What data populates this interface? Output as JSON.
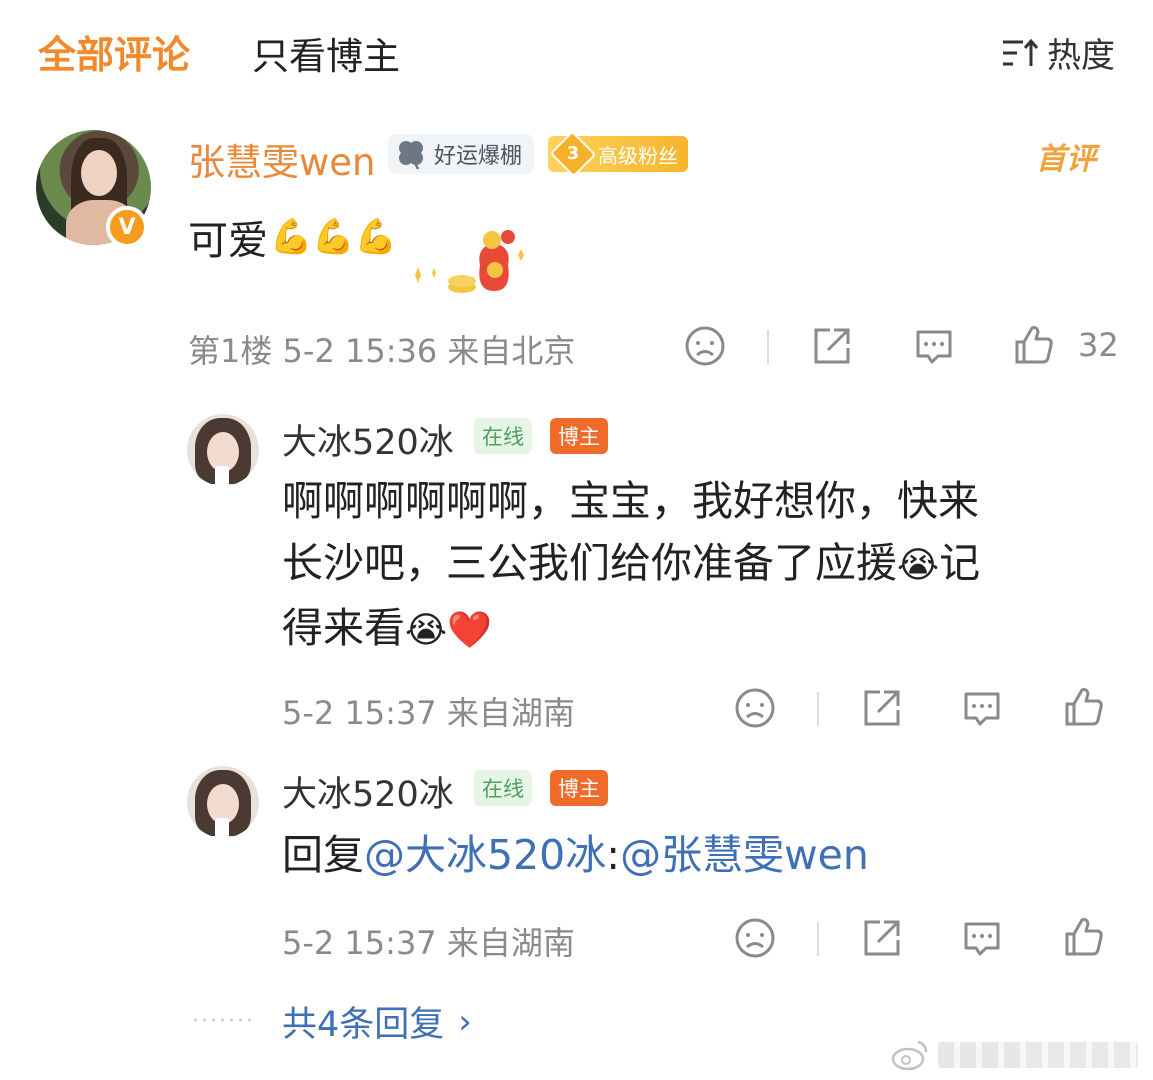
{
  "tabs": {
    "all_comments": "全部评论",
    "blogger_only": "只看博主",
    "sort_label": "热度",
    "sort_icon": "sort-icon"
  },
  "main_comment": {
    "author": "张慧雯wen",
    "verified_badge": "V",
    "luck_badge": "好运爆棚",
    "fan_level": "3",
    "fan_badge": "高级粉丝",
    "first_label": "首评",
    "text": "可爱",
    "emoji": "💪💪💪",
    "floor": "第1楼",
    "time": "5-2 15:36",
    "location": "来自北京",
    "like_count": "32"
  },
  "replies": [
    {
      "author": "大冰520冰",
      "tag_online": "在线",
      "tag_blogger": "博主",
      "text_lines": [
        "啊啊啊啊啊啊，宝宝，我好想你，快来",
        "长沙吧，三公我们给你准备了应援"
      ],
      "text_suffix_1": "记",
      "text_line3": "得来看",
      "emoji_cry": "😭",
      "emoji_heart": "❤️",
      "time": "5-2 15:37",
      "location": "来自湖南"
    },
    {
      "author": "大冰520冰",
      "tag_online": "在线",
      "tag_blogger": "博主",
      "text_prefix": "回复",
      "mention_1": "@大冰520冰",
      "separator": ":",
      "mention_2": "@张慧雯wen",
      "time": "5-2 15:37",
      "location": "来自湖南"
    }
  ],
  "more_replies": {
    "dots": "·······",
    "label": "共4条回复",
    "chevron": "›"
  },
  "colors": {
    "accent_orange": "#f08a2c",
    "link_blue": "#3f6fb5",
    "meta_gray": "#8a8a8a"
  }
}
